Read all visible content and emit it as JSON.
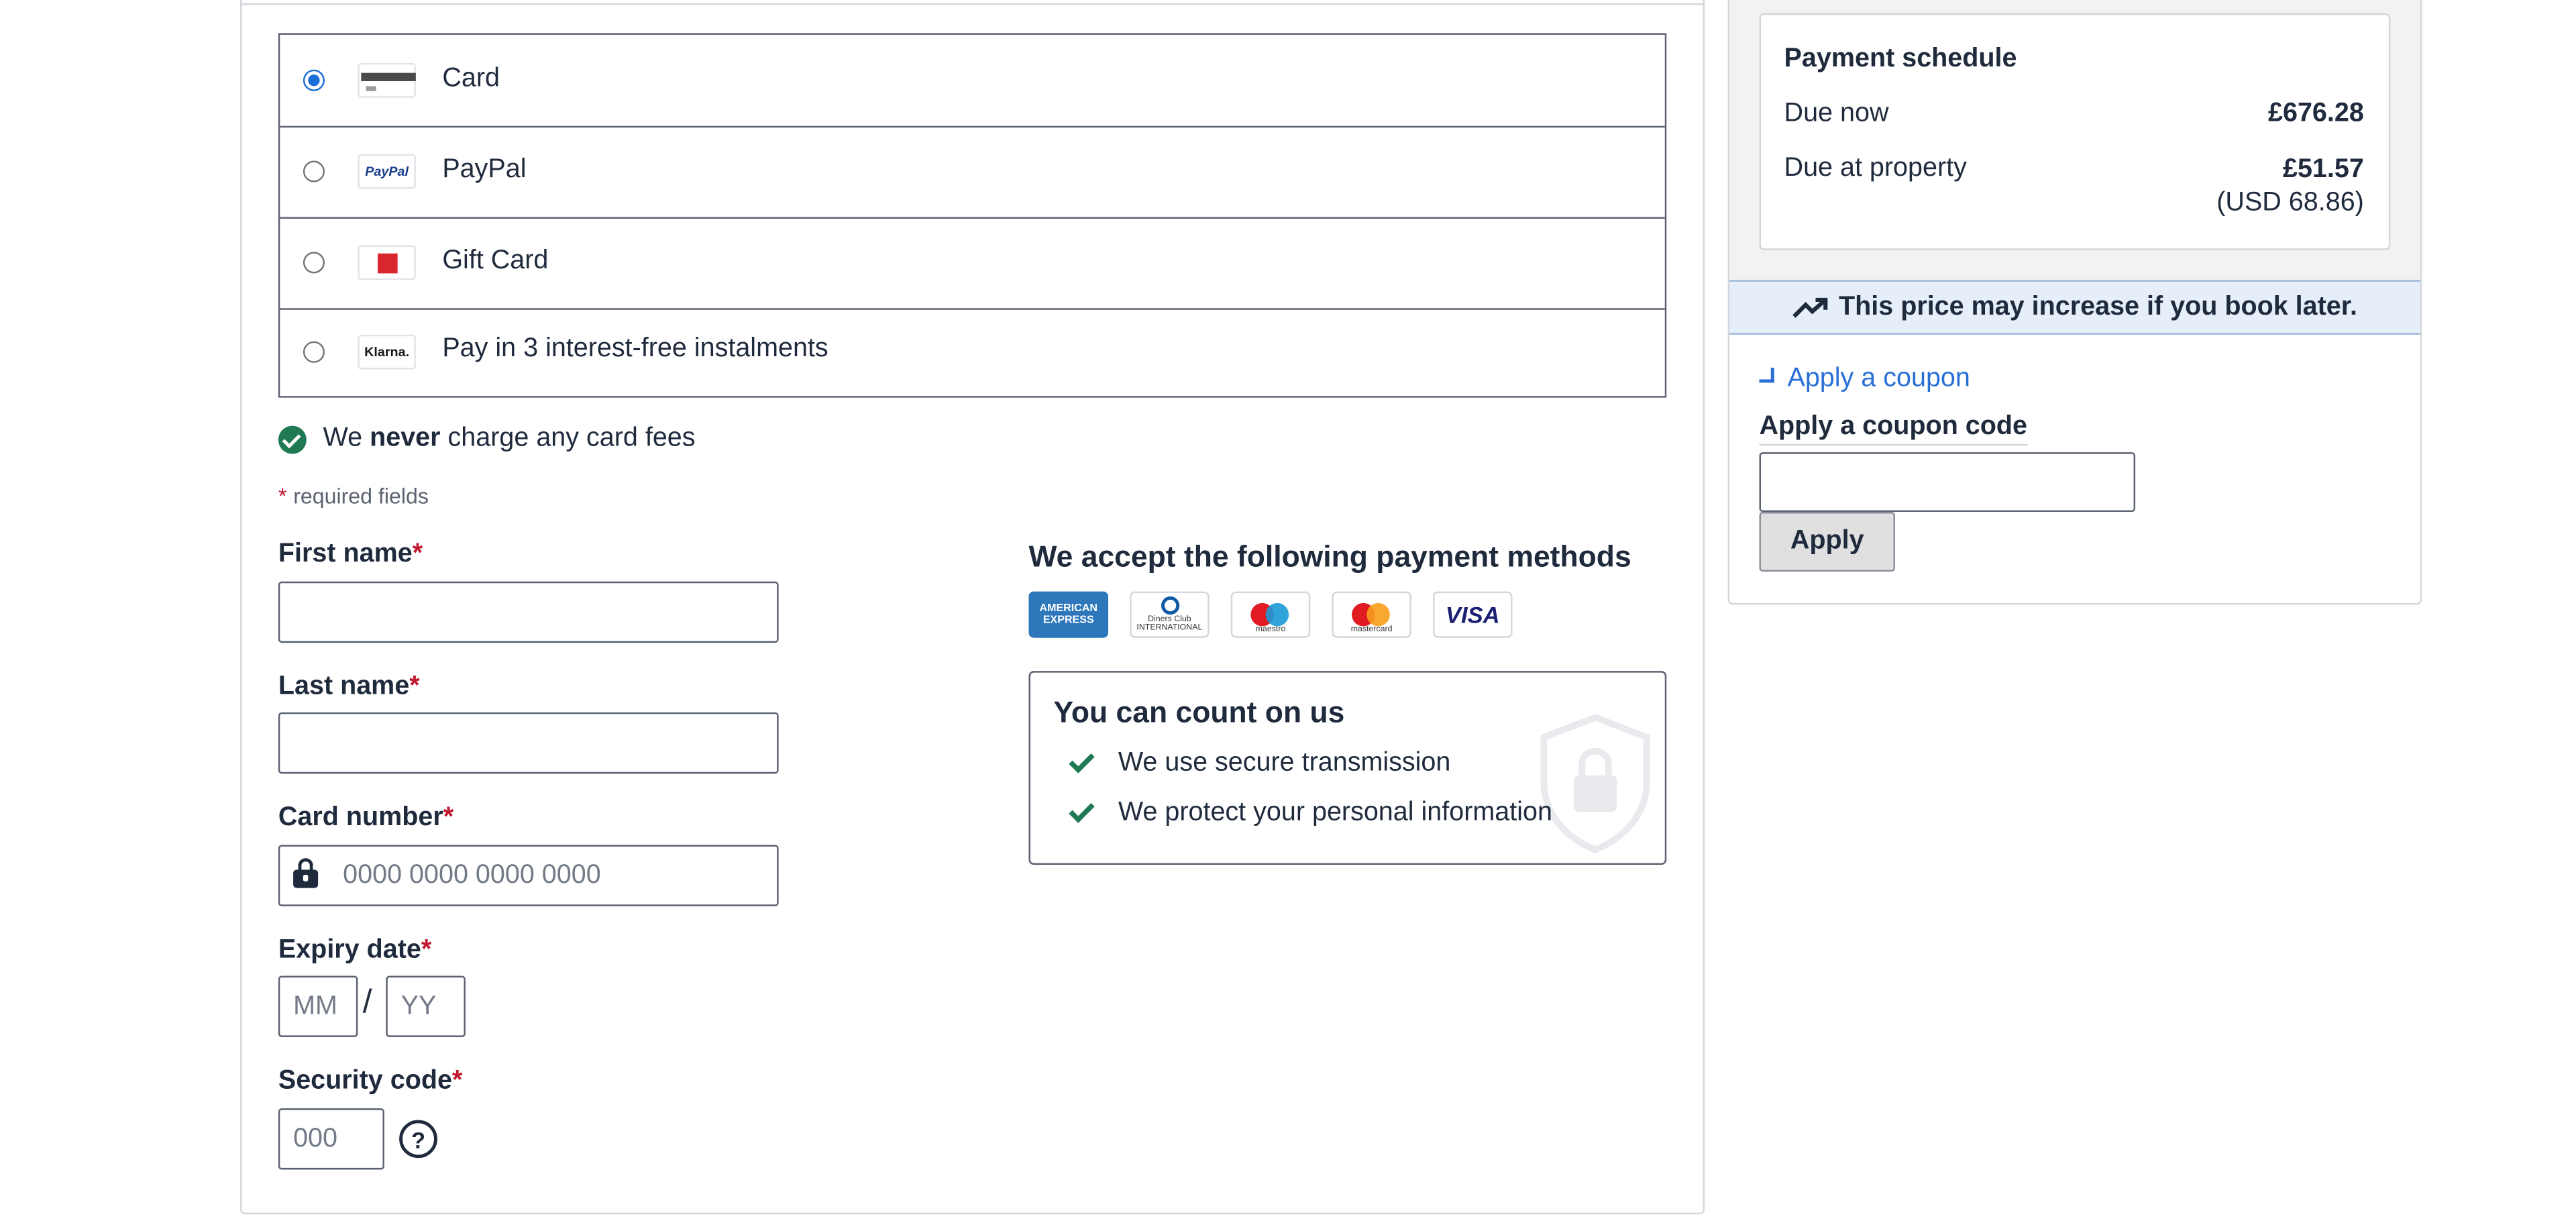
{
  "payment_options": [
    {
      "label": "Card",
      "icon": "credit-card-icon",
      "selected": true
    },
    {
      "label": "PayPal",
      "icon": "paypal-icon",
      "logo_text": "PayPal",
      "selected": false
    },
    {
      "label": "Gift Card",
      "icon": "gift-card-icon",
      "selected": false
    },
    {
      "label": "Pay in 3 interest-free instalments",
      "icon": "klarna-icon",
      "logo_text": "Klarna.",
      "selected": false
    }
  ],
  "fees_note": {
    "pre": "We",
    "bold": "never",
    "post": "charge any card fees"
  },
  "required_note": {
    "star": "*",
    "text": "required fields"
  },
  "form": {
    "first_name_label": "First name",
    "last_name_label": "Last name",
    "card_number_label": "Card number",
    "card_number_placeholder": "0000 0000 0000 0000",
    "expiry_label": "Expiry date",
    "expiry_month_placeholder": "MM",
    "expiry_separator": "/",
    "expiry_year_placeholder": "YY",
    "security_label": "Security code",
    "security_placeholder": "000",
    "help_glyph": "?",
    "required_star": "*"
  },
  "accepted": {
    "title": "We accept the following payment methods",
    "brands": [
      {
        "name": "American Express",
        "icon": "amex-icon",
        "text": "AMERICAN EXPRESS"
      },
      {
        "name": "Diners Club",
        "icon": "diners-club-icon",
        "text": "Diners Club INTERNATIONAL"
      },
      {
        "name": "Maestro",
        "icon": "maestro-icon",
        "text": "maestro"
      },
      {
        "name": "Mastercard",
        "icon": "mastercard-icon",
        "text": "mastercard"
      },
      {
        "name": "Visa",
        "icon": "visa-icon",
        "text": "VISA"
      }
    ]
  },
  "trust": {
    "title": "You can count on us",
    "items": [
      "We use secure transmission",
      "We protect your personal information"
    ]
  },
  "schedule": {
    "title": "Payment schedule",
    "due_now_label": "Due now",
    "due_now_value": "£676.28",
    "due_property_label": "Due at property",
    "due_property_value": "£51.57",
    "due_property_usd": "(USD 68.86)"
  },
  "price_banner": {
    "text": "This price may increase if you book later.",
    "icon": "trending-up-icon"
  },
  "coupon": {
    "toggle_label": "Apply a coupon",
    "field_label": "Apply a coupon code",
    "input_value": "",
    "apply_label": "Apply"
  },
  "colors": {
    "accent_blue": "#1a6fd6",
    "success_green": "#1f7a54",
    "required_red": "#c0172e",
    "banner_blue": "#e5eef9"
  }
}
